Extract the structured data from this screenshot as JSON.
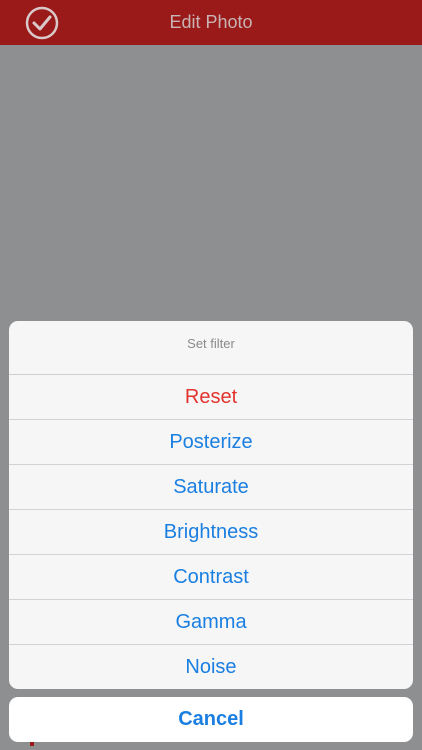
{
  "navbar": {
    "title": "Edit Photo",
    "confirm_icon": "checkmark-circle-icon",
    "background_color": "#9a1a1a"
  },
  "action_sheet": {
    "title": "Set filter",
    "items": [
      {
        "label": "Reset",
        "destructive": true
      },
      {
        "label": "Posterize"
      },
      {
        "label": "Saturate"
      },
      {
        "label": "Brightness"
      },
      {
        "label": "Contrast"
      },
      {
        "label": "Gamma"
      },
      {
        "label": "Noise"
      }
    ],
    "cancel_label": "Cancel",
    "accent_color": "#1a7fe0",
    "destructive_color": "#e2332e"
  }
}
